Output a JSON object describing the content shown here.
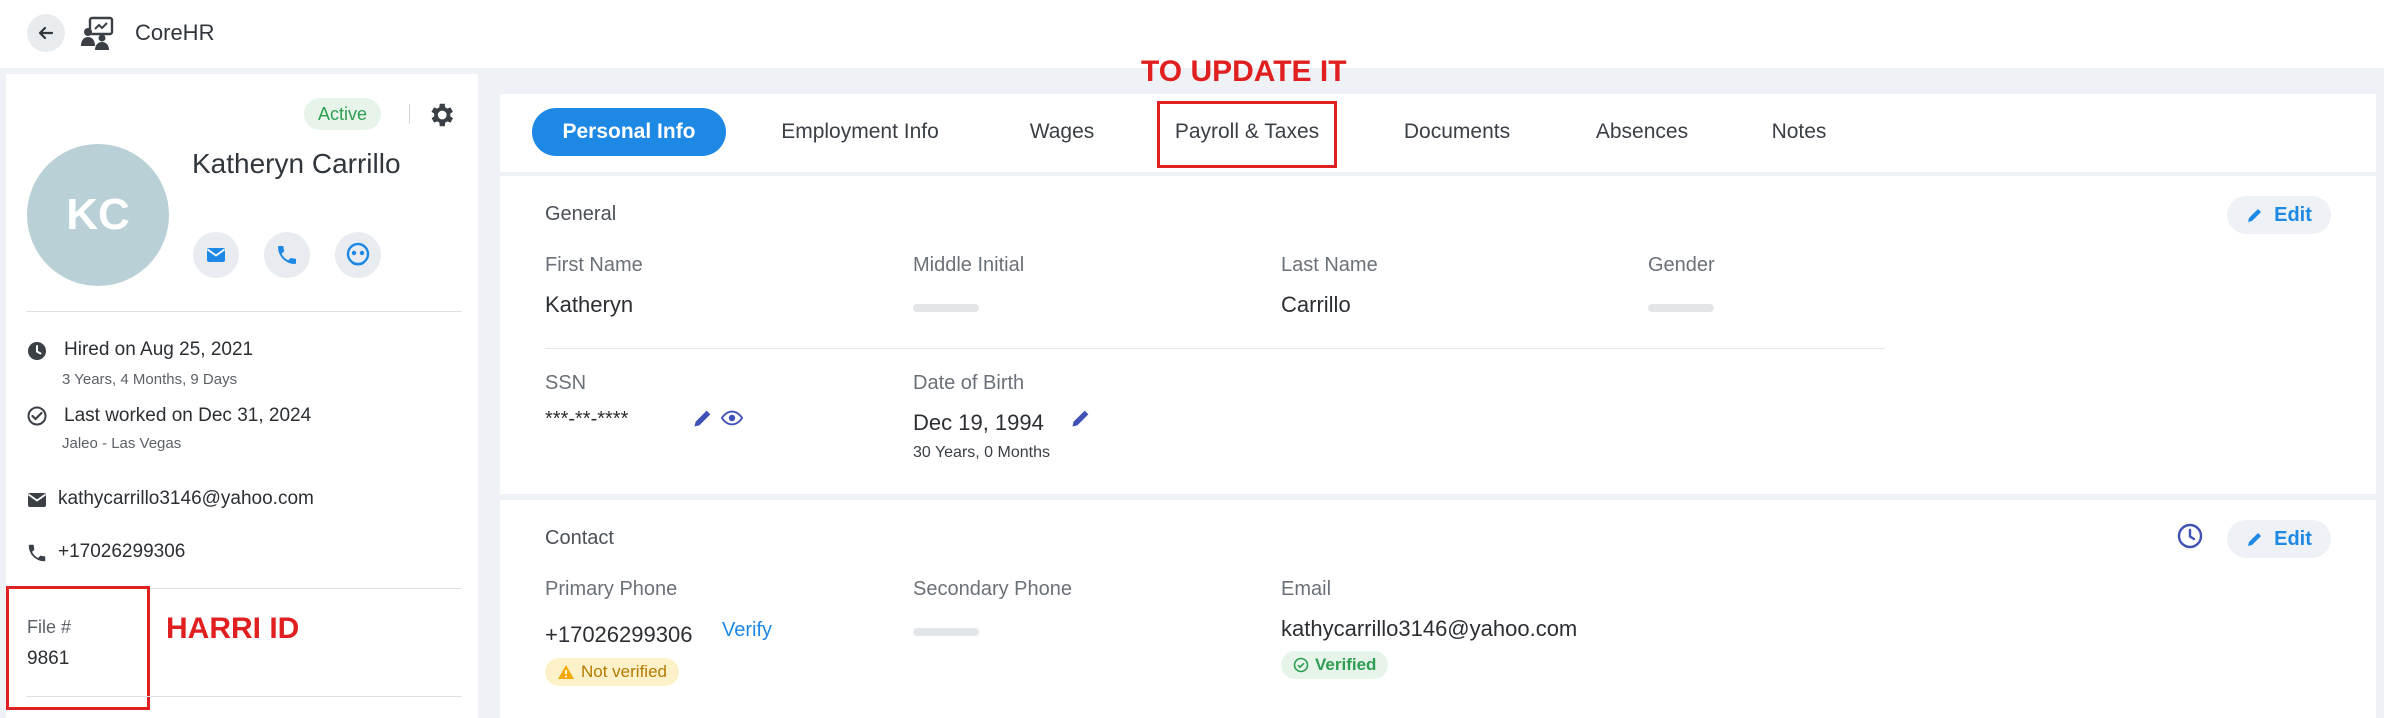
{
  "app": {
    "title": "CoreHR"
  },
  "profile": {
    "status": "Active",
    "initials": "KC",
    "name": "Katheryn Carrillo",
    "hired": "Hired on Aug 25, 2021",
    "tenure": "3 Years, 4 Months, 9 Days",
    "last_worked": "Last worked on Dec 31, 2024",
    "location": "Jaleo - Las Vegas",
    "email": "kathycarrillo3146@yahoo.com",
    "phone": "+17026299306",
    "file_label": "File #",
    "file_value": "9861"
  },
  "annotations": {
    "harri_id": "HARRI ID",
    "to_update": "TO UPDATE IT"
  },
  "tabs": [
    {
      "label": "Personal Info"
    },
    {
      "label": "Employment Info"
    },
    {
      "label": "Wages"
    },
    {
      "label": "Payroll & Taxes"
    },
    {
      "label": "Documents"
    },
    {
      "label": "Absences"
    },
    {
      "label": "Notes"
    }
  ],
  "general": {
    "title": "General",
    "edit_label": "Edit",
    "first_name_label": "First Name",
    "first_name": "Katheryn",
    "middle_initial_label": "Middle Initial",
    "last_name_label": "Last Name",
    "last_name": "Carrillo",
    "gender_label": "Gender",
    "ssn_label": "SSN",
    "ssn": "***-**-****",
    "dob_label": "Date of Birth",
    "dob": "Dec 19, 1994",
    "age": "30 Years, 0 Months"
  },
  "contact": {
    "title": "Contact",
    "edit_label": "Edit",
    "primary_phone_label": "Primary Phone",
    "primary_phone": "+17026299306",
    "verify_label": "Verify",
    "not_verified": "Not verified",
    "secondary_phone_label": "Secondary Phone",
    "email_label": "Email",
    "email": "kathycarrillo3146@yahoo.com",
    "verified": "Verified"
  },
  "colors": {
    "primary": "#1e88e5",
    "annotation": "#e02020",
    "success": "#2e9e52",
    "warning": "#b37a00"
  }
}
